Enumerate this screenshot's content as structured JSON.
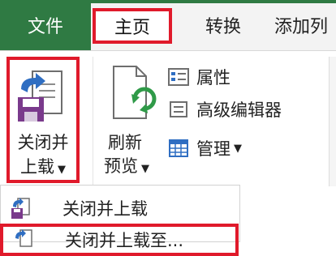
{
  "tabs": {
    "file": "文件",
    "home": "主页",
    "convert": "转换",
    "add": "添加列"
  },
  "ribbon": {
    "close_load_line1": "关闭并",
    "close_load_line2": "上载",
    "refresh_line1": "刷新",
    "refresh_line2": "预览",
    "properties": "属性",
    "advanced_editor": "高级编辑器",
    "manage": "管理"
  },
  "dropdown": {
    "item1": "关闭并上载",
    "item2": "关闭并上载至..."
  },
  "colors": {
    "file_tab": "#2f7a43",
    "highlight": "#e01a2b"
  }
}
